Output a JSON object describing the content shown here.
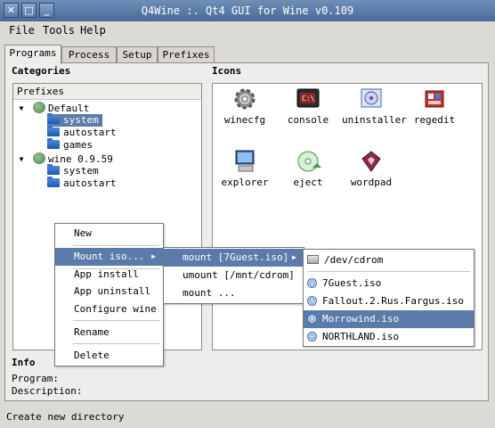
{
  "window": {
    "title": "Q4Wine :. Qt4 GUI for Wine v0.109"
  },
  "titlebar_buttons": [
    "✕",
    "□",
    "_"
  ],
  "menu": [
    "File",
    "Tools",
    "Help"
  ],
  "tabs": [
    "Programs",
    "Process",
    "Setup",
    "Prefixes"
  ],
  "active_tab": "Programs",
  "categories": {
    "heading": "Categories",
    "header": "Prefixes",
    "tree": [
      {
        "label": "Default",
        "icon": "wine-icon"
      },
      {
        "label": "system",
        "icon": "folder-icon",
        "selected": true
      },
      {
        "label": "autostart",
        "icon": "folder-icon"
      },
      {
        "label": "games",
        "icon": "folder-icon"
      },
      {
        "label": "wine 0.9.59",
        "icon": "wine-icon"
      },
      {
        "label": "system",
        "icon": "folder-icon"
      },
      {
        "label": "autostart",
        "icon": "folder-icon"
      }
    ]
  },
  "icons": {
    "heading": "Icons",
    "items": [
      {
        "label": "winecfg",
        "icon": "gear-icon"
      },
      {
        "label": "console",
        "icon": "console-icon"
      },
      {
        "label": "uninstaller",
        "icon": "uninstaller-icon"
      },
      {
        "label": "regedit",
        "icon": "regedit-icon"
      },
      {
        "label": "explorer",
        "icon": "computer-icon"
      },
      {
        "label": "eject",
        "icon": "eject-icon"
      },
      {
        "label": "wordpad",
        "icon": "wordpad-icon"
      }
    ]
  },
  "info": {
    "heading": "Info",
    "program_label": "Program:",
    "description_label": "Description:"
  },
  "context_menu": {
    "items": [
      "New",
      "Mount iso...",
      "App install",
      "App uninstall",
      "Configure wine",
      "Rename",
      "Delete"
    ],
    "highlighted": "Mount iso..."
  },
  "mount_submenu": {
    "items": [
      "mount [7Guest.iso]",
      "umount [/mnt/cdrom]",
      "mount ..."
    ],
    "highlighted": "mount [7Guest.iso]"
  },
  "iso_submenu": {
    "items": [
      "/dev/cdrom",
      "7Guest.iso",
      "Fallout.2.Rus.Fargus.iso",
      "Morrowind.iso",
      "NORTHLAND.iso"
    ],
    "highlighted": "Morrowind.iso"
  },
  "statusbar": {
    "text": "Create new directory"
  },
  "colors": {
    "selection": "#5b7bab",
    "titlebar": "#4a6a98"
  }
}
